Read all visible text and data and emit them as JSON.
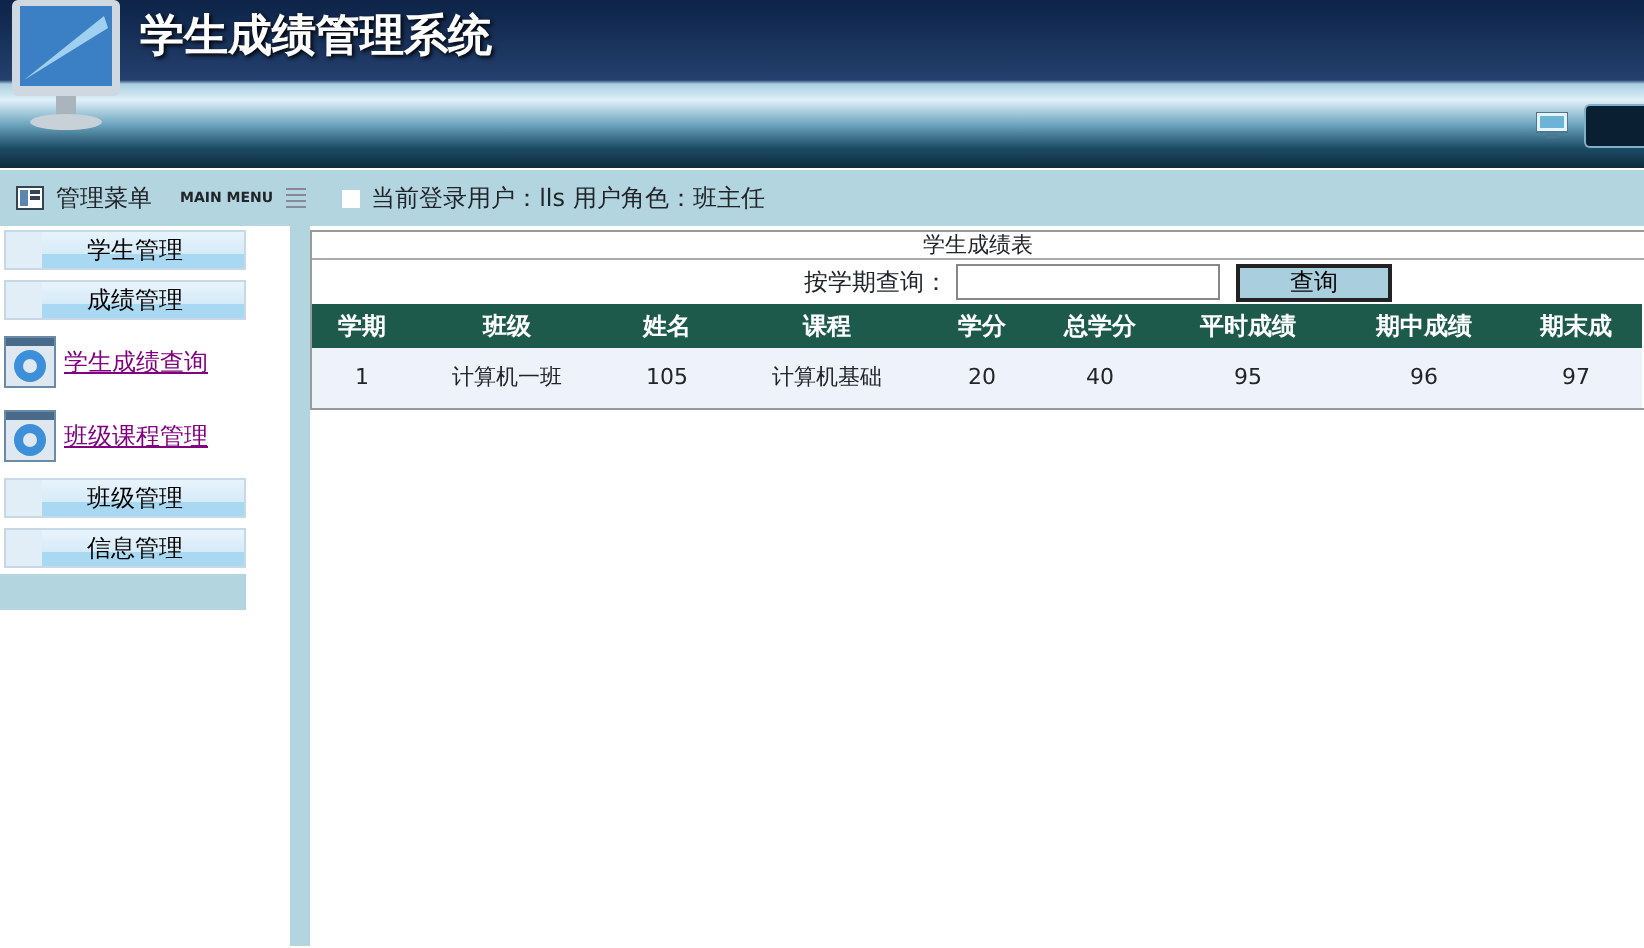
{
  "header": {
    "title": "学生成绩管理系统"
  },
  "menu_bar": {
    "title": "管理菜单",
    "subtitle": "MAIN MENU",
    "user_label": "当前登录用户：",
    "user": "lls",
    "role_label": "用户角色：",
    "role": "班主任"
  },
  "sidebar": {
    "items": [
      {
        "kind": "section",
        "label": "学生管理"
      },
      {
        "kind": "section",
        "label": "成绩管理"
      },
      {
        "kind": "link",
        "label": "学生成绩查询"
      },
      {
        "kind": "link",
        "label": "班级课程管理"
      },
      {
        "kind": "section",
        "label": "班级管理"
      },
      {
        "kind": "section",
        "label": "信息管理"
      }
    ]
  },
  "table": {
    "title": "学生成绩表",
    "search_label": "按学期查询：",
    "search_button": "查询",
    "columns": [
      "学期",
      "班级",
      "姓名",
      "课程",
      "学分",
      "总学分",
      "平时成绩",
      "期中成绩",
      "期末成"
    ],
    "rows": [
      [
        "1",
        "计算机一班",
        "105",
        "计算机基础",
        "20",
        "40",
        "95",
        "96",
        "97"
      ]
    ]
  }
}
